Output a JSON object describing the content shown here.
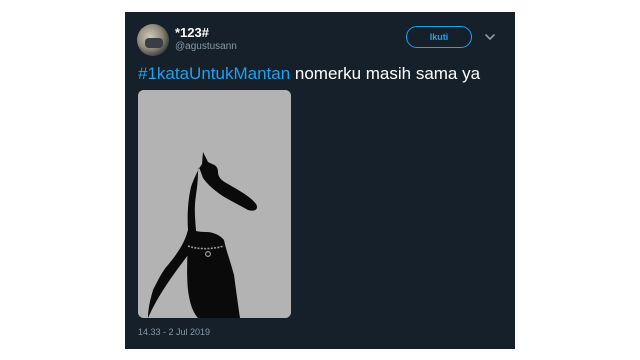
{
  "tweet": {
    "display_name": "*123#",
    "handle": "@agustusann",
    "follow_label": "Ikuti",
    "hashtag": "#1kataUntukMantan",
    "text": " nomerku masih sama ya",
    "timestamp": "14.33 - 2 Jul 2019"
  },
  "icons": {
    "avatar": "user-avatar",
    "more": "chevron-down-icon",
    "media": "dog-silhouette-photo"
  },
  "colors": {
    "background": "#15202b",
    "accent": "#1da1f2",
    "secondary_text": "#8899a6",
    "media_background": "#b3b3b3"
  }
}
